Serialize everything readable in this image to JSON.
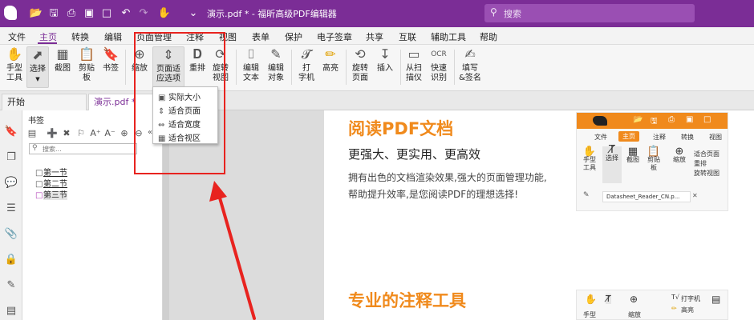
{
  "app": {
    "title": "演示.pdf * - 福昕高级PDF编辑器",
    "search_placeholder": "搜索",
    "brand_color": "#7b2d96"
  },
  "quick_access": [
    "open-icon",
    "save-icon",
    "print-icon",
    "window-icon",
    "undo-icon",
    "redo-icon",
    "hand-icon",
    "dropdown-icon"
  ],
  "menu": {
    "items": [
      "文件",
      "主页",
      "转换",
      "编辑",
      "页面管理",
      "注释",
      "视图",
      "表单",
      "保护",
      "电子签章",
      "共享",
      "互联",
      "辅助工具",
      "帮助"
    ],
    "active": "主页"
  },
  "ribbon": {
    "hand": "手型\n工具",
    "select": "选择",
    "screenshot": "截图",
    "clipboard": "剪贴\n板",
    "bookmark": "书签",
    "zoom": "缩放",
    "fit_page": "页面适\n应选项",
    "reflow": "重排",
    "rotate_view": "旋转\n视图",
    "edit_text": "编辑\n文本",
    "edit_object": "编辑\n对象",
    "typewriter": "打\n字机",
    "highlight": "高亮",
    "rotate_page": "旋转\n页面",
    "insert": "插入",
    "from_scanner": "从扫\n描仪",
    "quick_ocr": "快速\n识别",
    "fill_sign": "填写\n&签名"
  },
  "dropdown": {
    "items": [
      "实际大小",
      "适合页面",
      "适合宽度",
      "适合视区"
    ]
  },
  "tabs": {
    "start": "开始",
    "doc": "演示.pdf *"
  },
  "bookmarks": {
    "title": "书签",
    "search_placeholder": "搜索...",
    "items": [
      "第一节",
      "第二节",
      "第三节"
    ]
  },
  "document": {
    "heading1": "阅读PDF文档",
    "subheading": "更强大、更实用、更高效",
    "para_line1": "拥有出色的文档渲染效果,强大的页面管理功能,",
    "para_line2": "帮助提升效率,是您阅读PDF的理想选择!",
    "heading2": "专业的注释工具"
  },
  "inset_shot1": {
    "menu": [
      "文件",
      "主页",
      "注释",
      "转换",
      "视图"
    ],
    "tools": [
      "手型\n工具",
      "选择",
      "截图",
      "剪贴\n板",
      "缩放"
    ],
    "side": [
      "适合页面",
      "重排",
      "旋转视图"
    ],
    "tab": "Datasheet_Reader_CN.p..."
  },
  "inset_shot2": {
    "labels": [
      "手型",
      "缩放",
      "打字机",
      "高亮"
    ]
  },
  "annotation_color": "#e8231f"
}
